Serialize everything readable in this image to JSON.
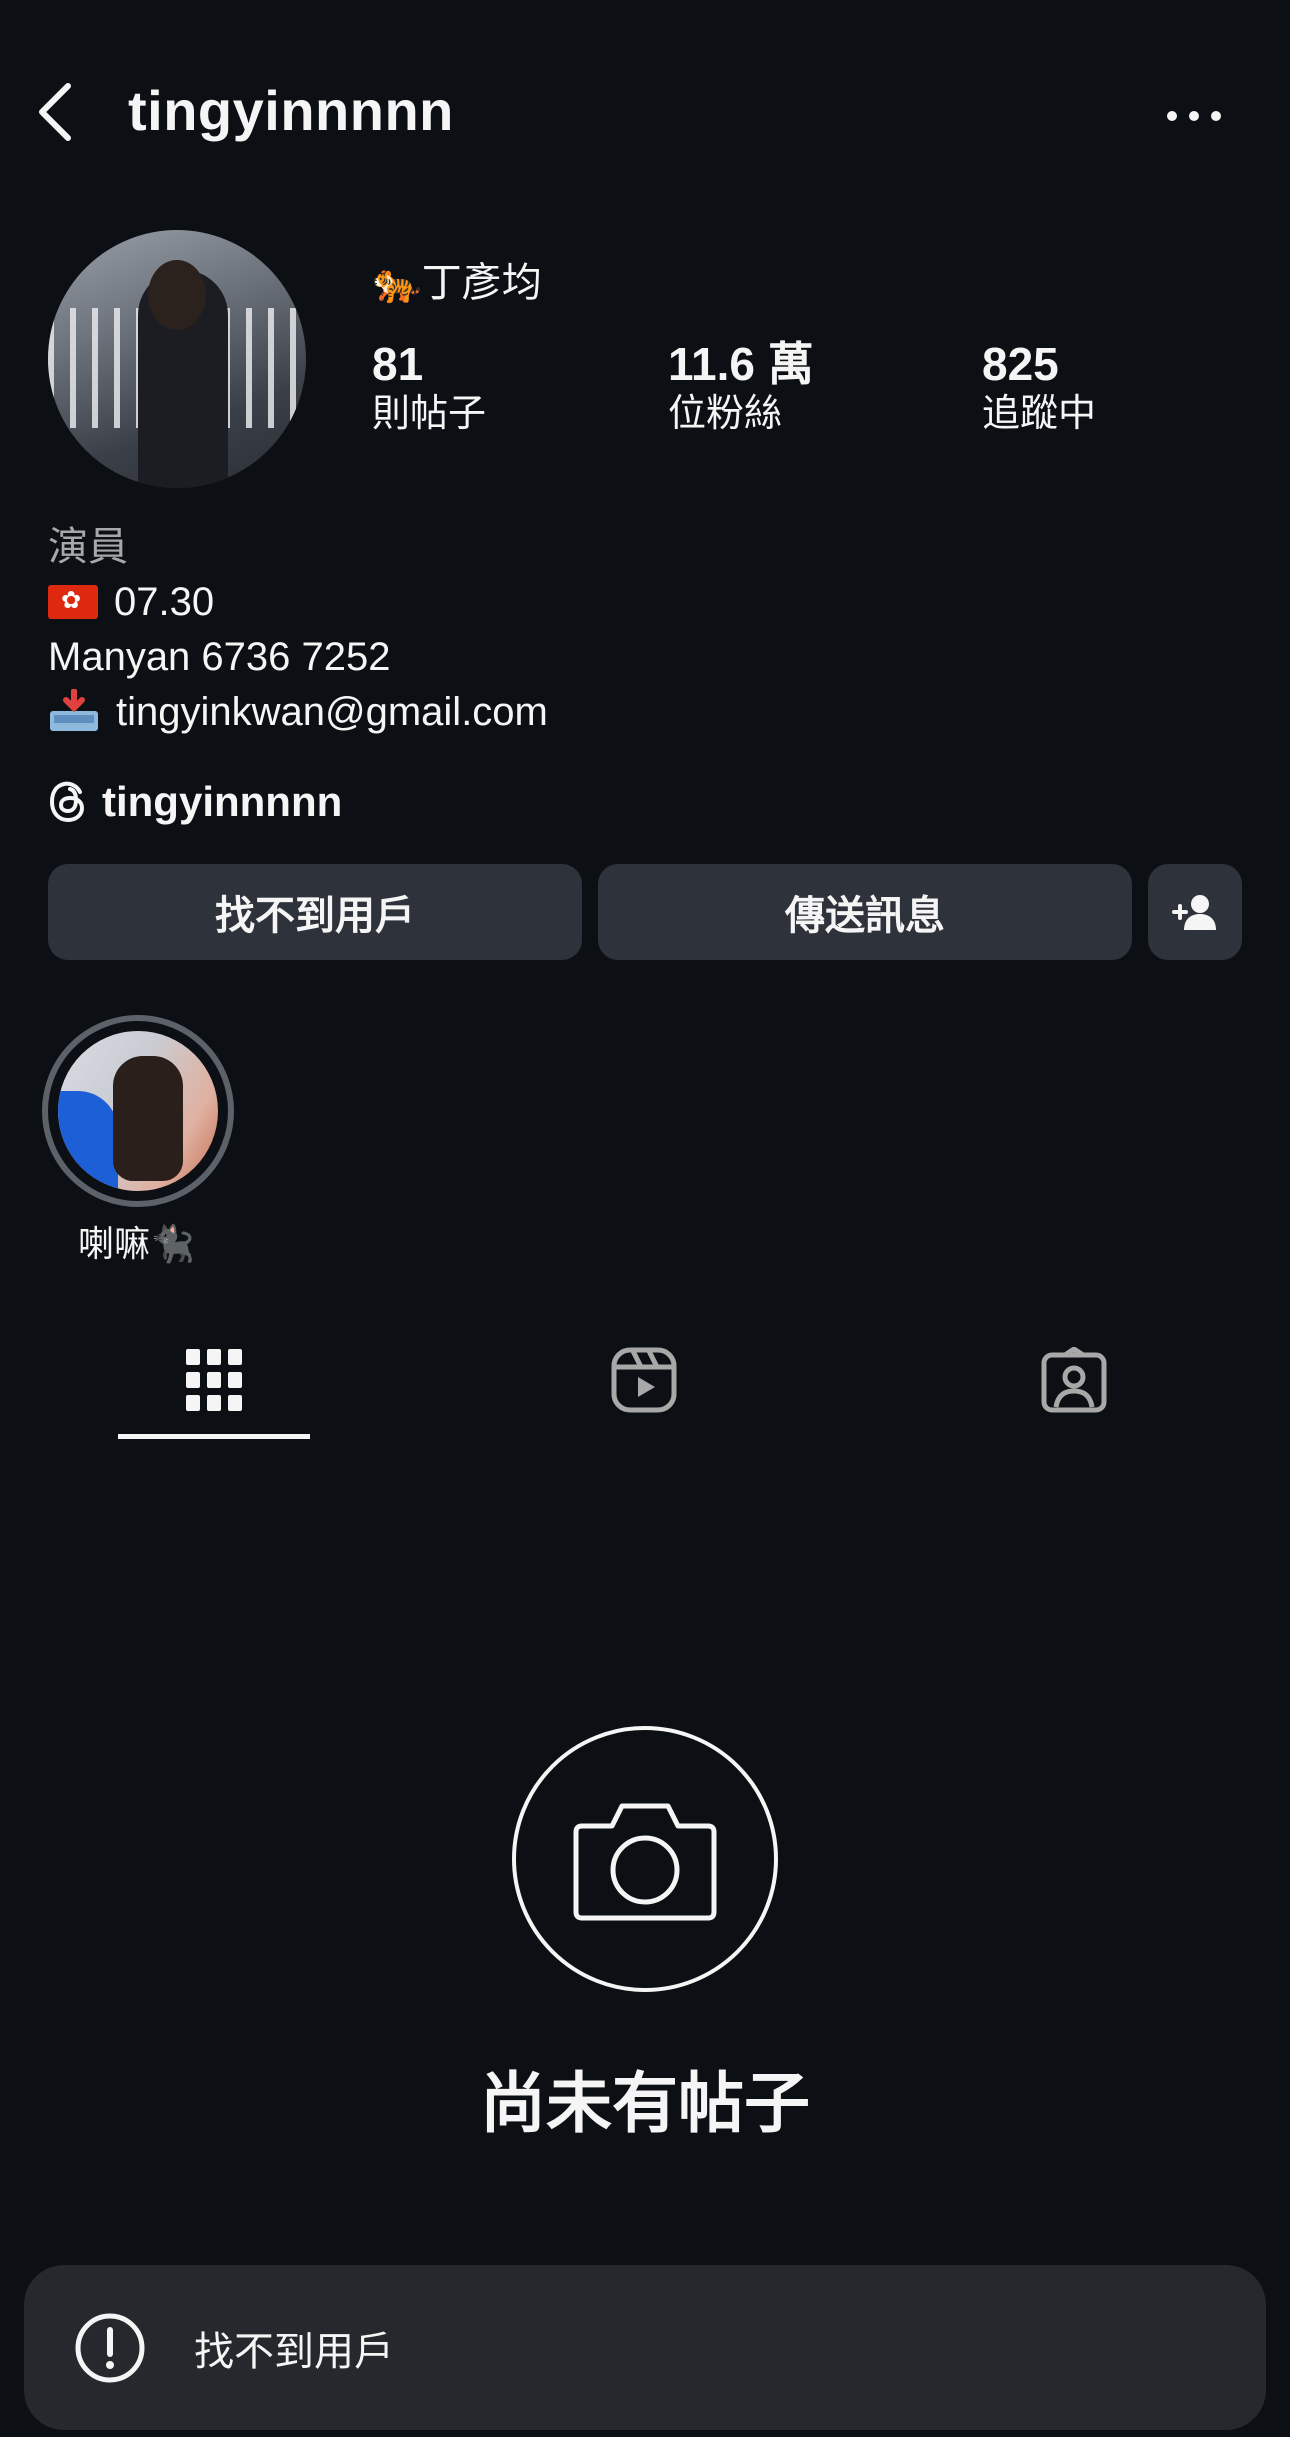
{
  "header": {
    "username": "tingyinnnnn"
  },
  "profile": {
    "full_name": "🐅丁彥均",
    "stats": {
      "posts": {
        "value": "81",
        "label": "則帖子"
      },
      "followers": {
        "value": "11.6 萬",
        "label": "位粉絲"
      },
      "following": {
        "value": "825",
        "label": "追蹤中"
      }
    },
    "bio": {
      "category": "演員",
      "birthday": "07.30",
      "manager": "Manyan 6736 7252",
      "email": "tingyinkwan@gmail.com"
    },
    "threads_handle": "tingyinnnnn"
  },
  "buttons": {
    "not_found": "找不到用戶",
    "message": "傳送訊息"
  },
  "highlights": [
    {
      "label": "喇嘛🐈‍⬛"
    }
  ],
  "empty_state": {
    "title": "尚未有帖子"
  },
  "toast": {
    "text": "找不到用戶"
  },
  "colors": {
    "background": "#0c1014",
    "button_bg": "#2e333b",
    "toast_bg": "#25282c"
  }
}
